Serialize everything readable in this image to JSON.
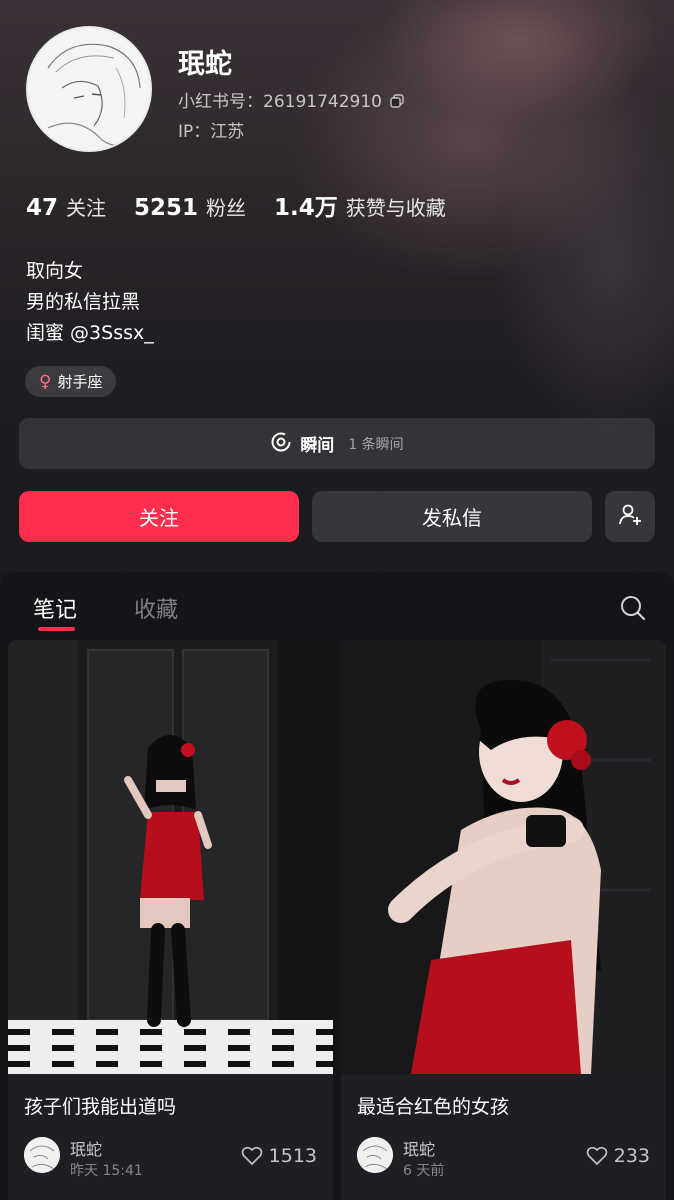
{
  "profile": {
    "name": "珉蛇",
    "uid": "小红书号：26191742910",
    "ip": "IP：江苏",
    "stats": [
      {
        "num": "47",
        "label": "关注"
      },
      {
        "num": "5251",
        "label": "粉丝"
      },
      {
        "num": "1.4万",
        "label": "获赞与收藏"
      }
    ],
    "bio": [
      "取向女",
      "男的私信拉黑",
      "闺蜜 @3Sssx_"
    ],
    "tag": "射手座",
    "tag_symbol": "♀"
  },
  "moments": {
    "label": "瞬间",
    "count": "1 条瞬间"
  },
  "actions": {
    "follow": "关注",
    "message": "发私信"
  },
  "tabs": [
    {
      "label": "笔记",
      "active": true
    },
    {
      "label": "收藏",
      "active": false
    }
  ],
  "notes": [
    {
      "title": "孩子们我能出道吗",
      "author": "珉蛇",
      "time": "昨天 15:41",
      "likes": "1513"
    },
    {
      "title": "最适合红色的女孩",
      "author": "珉蛇",
      "time": "6 天前",
      "likes": "233"
    }
  ],
  "colors": {
    "accent": "#ff2e4d",
    "background": "#111216"
  }
}
